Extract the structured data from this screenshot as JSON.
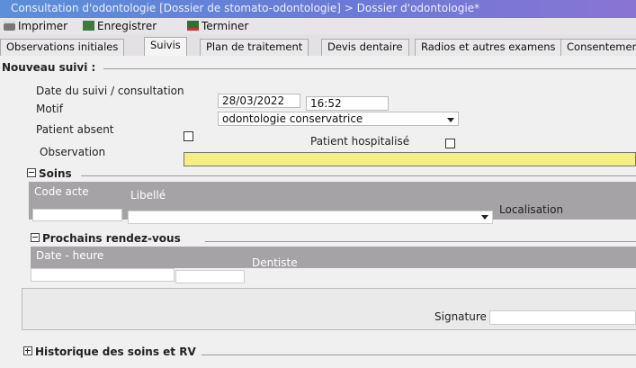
{
  "window": {
    "title": "Consultation d'odontologie [Dossier de stomato-odontologie] > Dossier d'odontologie*"
  },
  "toolbar": {
    "print": "Imprimer",
    "save": "Enregistrer",
    "finish": "Terminer"
  },
  "tabs": [
    {
      "label": "Observations initiales",
      "active": false
    },
    {
      "label": "Suivis",
      "active": true
    },
    {
      "label": "Plan de traitement",
      "active": false
    },
    {
      "label": "Devis dentaire",
      "active": false
    },
    {
      "label": "Radios et autres examens",
      "active": false
    },
    {
      "label": "Consentemen",
      "active": false
    }
  ],
  "form": {
    "section_title": "Nouveau suivi :",
    "date_label": "Date du suivi / consultation",
    "date_value": "28/03/2022",
    "time_value": "16:52",
    "motif_label": "Motif",
    "motif_value": "odontologie conservatrice",
    "absent_label": "Patient absent",
    "hospitalized_label": "Patient hospitalisé",
    "observation_label": "Observation",
    "observation_value": ""
  },
  "soins": {
    "title": "Soins",
    "col_code": "Code acte",
    "col_libelle": "Libellé",
    "col_localisation": "Localisation"
  },
  "rdv": {
    "title": "Prochains rendez-vous",
    "col_date": "Date - heure",
    "col_dentiste": "Dentiste"
  },
  "signature_label": "Signature",
  "history_title": "Historique des soins et RV",
  "colors": {
    "observation_bg": "#f3ef82",
    "grid_header": "#a5a3a6",
    "panel": "#f1f0f1"
  }
}
